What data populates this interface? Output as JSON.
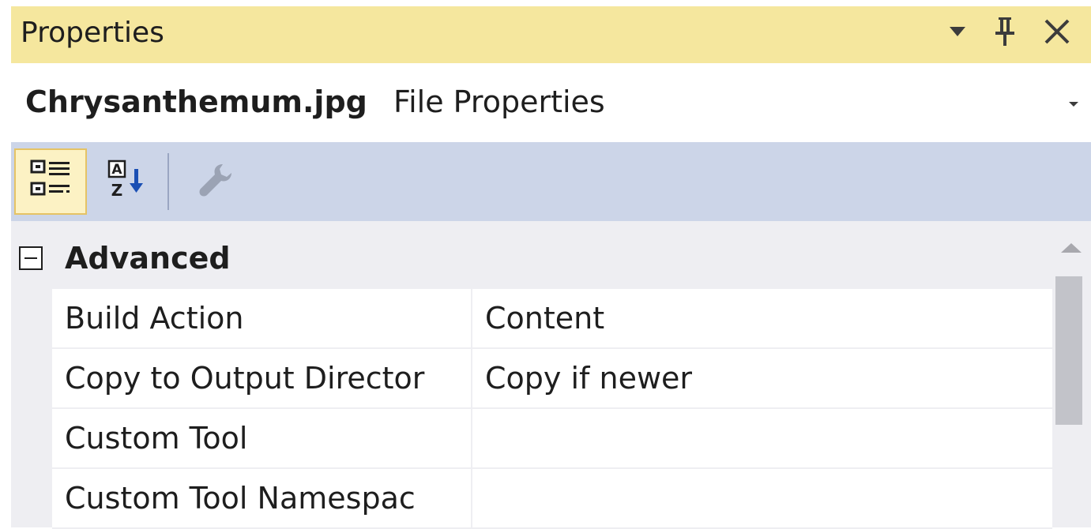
{
  "panel": {
    "title": "Properties"
  },
  "title_buttons": {
    "dropdown_icon": "caret-down-icon",
    "pin_icon": "pin-icon",
    "close_icon": "close-icon"
  },
  "object_selector": {
    "name": "Chrysanthemum.jpg",
    "type": "File Properties",
    "dropdown_icon": "caret-down-icon"
  },
  "toolbar": {
    "buttons": [
      {
        "name": "categorized",
        "icon": "categorized-icon",
        "active": true
      },
      {
        "name": "alphabetical",
        "icon": "sort-az-icon",
        "active": false
      },
      {
        "name": "property-pages",
        "icon": "wrench-icon",
        "active": false,
        "disabled": true
      }
    ]
  },
  "grid": {
    "category": {
      "label": "Advanced",
      "expanded": true
    },
    "rows": [
      {
        "name": "Build Action",
        "value": "Content"
      },
      {
        "name": "Copy to Output Director",
        "value": "Copy if newer"
      },
      {
        "name": "Custom Tool",
        "value": ""
      },
      {
        "name": "Custom Tool Namespac",
        "value": ""
      }
    ]
  },
  "colors": {
    "title_bar": "#f5e79e",
    "toolbar": "#ccd5e8",
    "grid_background": "#eeeef2",
    "active_button": "#fcf2c4",
    "active_button_border": "#e5c365",
    "sort_arrow": "#1a4fb4"
  }
}
